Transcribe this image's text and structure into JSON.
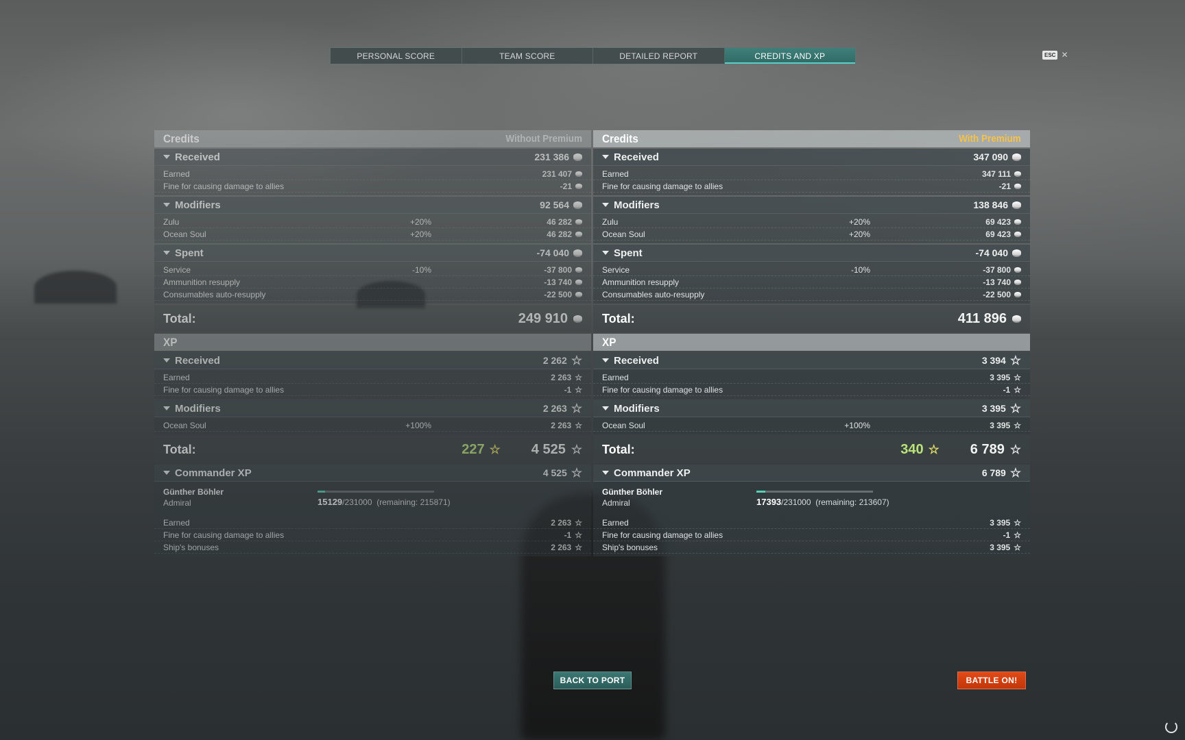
{
  "tabs": [
    "PERSONAL SCORE",
    "TEAM SCORE",
    "DETAILED REPORT",
    "CREDITS AND XP"
  ],
  "esc_label": "ESC",
  "close_glyph": "✕",
  "left": {
    "credits_title": "Credits",
    "premium_label": "Without Premium",
    "received": {
      "label": "Received",
      "value": "231 386",
      "rows": [
        {
          "name": "Earned",
          "value": "231 407"
        },
        {
          "name": "Fine for causing damage to allies",
          "value": "-21"
        }
      ]
    },
    "modifiers": {
      "label": "Modifiers",
      "value": "92 564",
      "rows": [
        {
          "name": "Zulu",
          "pct": "+20%",
          "value": "46 282"
        },
        {
          "name": "Ocean Soul",
          "pct": "+20%",
          "value": "46 282"
        }
      ]
    },
    "spent": {
      "label": "Spent",
      "value": "-74 040",
      "rows": [
        {
          "name": "Service",
          "pct": "-10%",
          "value": "-37 800"
        },
        {
          "name": "Ammunition resupply",
          "pct": "",
          "value": "-13 740"
        },
        {
          "name": "Consumables auto-resupply",
          "pct": "",
          "value": "-22 500"
        }
      ]
    },
    "credits_total_label": "Total:",
    "credits_total": "249 910",
    "xp_title": "XP",
    "xp_received": {
      "label": "Received",
      "value": "2 262",
      "rows": [
        {
          "name": "Earned",
          "value": "2 263"
        },
        {
          "name": "Fine for causing damage to allies",
          "value": "-1"
        }
      ]
    },
    "xp_modifiers": {
      "label": "Modifiers",
      "value": "2 263",
      "rows": [
        {
          "name": "Ocean Soul",
          "pct": "+100%",
          "value": "2 263"
        }
      ]
    },
    "xp_total_label": "Total:",
    "free_xp": "227",
    "xp_total": "4 525",
    "cmdr": {
      "label": "Commander XP",
      "value": "4 525",
      "name": "Günther Böhler",
      "rank": "Admiral",
      "xp_current": "15129",
      "xp_needed": "/231000",
      "remaining": "(remaining: 215871)",
      "progress": 0.065,
      "rows": [
        {
          "name": "Earned",
          "value": "2 263"
        },
        {
          "name": "Fine for causing damage to allies",
          "value": "-1"
        },
        {
          "name": "Ship's bonuses",
          "value": "2 263"
        }
      ]
    }
  },
  "right": {
    "credits_title": "Credits",
    "premium_label": "With Premium",
    "received": {
      "label": "Received",
      "value": "347 090",
      "rows": [
        {
          "name": "Earned",
          "value": "347 111"
        },
        {
          "name": "Fine for causing damage to allies",
          "value": "-21"
        }
      ]
    },
    "modifiers": {
      "label": "Modifiers",
      "value": "138 846",
      "rows": [
        {
          "name": "Zulu",
          "pct": "+20%",
          "value": "69 423"
        },
        {
          "name": "Ocean Soul",
          "pct": "+20%",
          "value": "69 423"
        }
      ]
    },
    "spent": {
      "label": "Spent",
      "value": "-74 040",
      "rows": [
        {
          "name": "Service",
          "pct": "-10%",
          "value": "-37 800"
        },
        {
          "name": "Ammunition resupply",
          "pct": "",
          "value": "-13 740"
        },
        {
          "name": "Consumables auto-resupply",
          "pct": "",
          "value": "-22 500"
        }
      ]
    },
    "credits_total_label": "Total:",
    "credits_total": "411 896",
    "xp_title": "XP",
    "xp_received": {
      "label": "Received",
      "value": "3 394",
      "rows": [
        {
          "name": "Earned",
          "value": "3 395"
        },
        {
          "name": "Fine for causing damage to allies",
          "value": "-1"
        }
      ]
    },
    "xp_modifiers": {
      "label": "Modifiers",
      "value": "3 395",
      "rows": [
        {
          "name": "Ocean Soul",
          "pct": "+100%",
          "value": "3 395"
        }
      ]
    },
    "xp_total_label": "Total:",
    "free_xp": "340",
    "xp_total": "6 789",
    "cmdr": {
      "label": "Commander XP",
      "value": "6 789",
      "name": "Günther Böhler",
      "rank": "Admiral",
      "xp_current": "17393",
      "xp_needed": "/231000",
      "remaining": "(remaining: 213607)",
      "progress": 0.075,
      "rows": [
        {
          "name": "Earned",
          "value": "3 395"
        },
        {
          "name": "Fine for causing damage to allies",
          "value": "-1"
        },
        {
          "name": "Ship's bonuses",
          "value": "3 395"
        }
      ]
    }
  },
  "buttons": {
    "back": "BACK TO PORT",
    "battle": "BATTLE ON!"
  }
}
